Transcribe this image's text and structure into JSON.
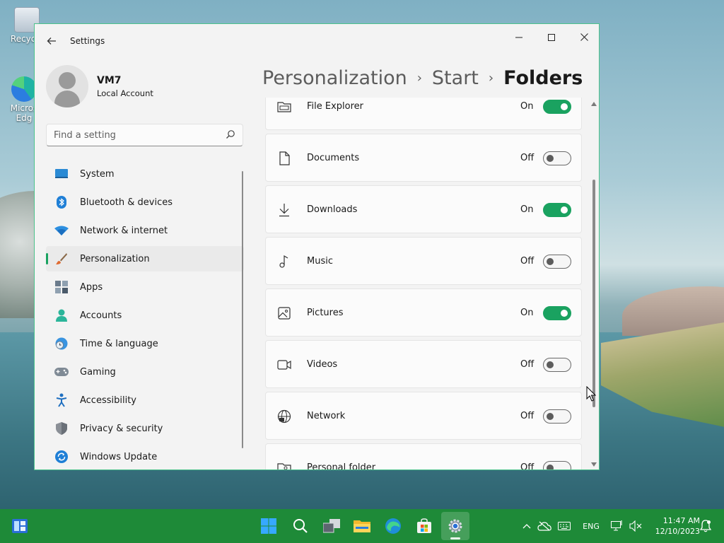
{
  "desktop": {
    "icons": [
      {
        "label": "Recycle"
      },
      {
        "label": "Micros"
      },
      {
        "label": "Edg"
      }
    ]
  },
  "window": {
    "app_title": "Settings",
    "controls": {
      "minimize": "—",
      "maximize": "☐",
      "close": "✕"
    }
  },
  "user": {
    "name": "VM7",
    "account_type": "Local Account"
  },
  "search": {
    "placeholder": "Find a setting"
  },
  "nav": {
    "items": [
      {
        "label": "System",
        "icon": "system-icon"
      },
      {
        "label": "Bluetooth & devices",
        "icon": "bluetooth-icon"
      },
      {
        "label": "Network & internet",
        "icon": "wifi-icon"
      },
      {
        "label": "Personalization",
        "icon": "paintbrush-icon",
        "selected": true
      },
      {
        "label": "Apps",
        "icon": "apps-icon"
      },
      {
        "label": "Accounts",
        "icon": "person-icon"
      },
      {
        "label": "Time & language",
        "icon": "globe-clock-icon"
      },
      {
        "label": "Gaming",
        "icon": "gamepad-icon"
      },
      {
        "label": "Accessibility",
        "icon": "accessibility-icon"
      },
      {
        "label": "Privacy & security",
        "icon": "shield-icon"
      },
      {
        "label": "Windows Update",
        "icon": "update-icon"
      }
    ]
  },
  "breadcrumb": {
    "items": [
      "Personalization",
      "Start",
      "Folders"
    ],
    "separator": "›"
  },
  "folders": [
    {
      "label": "File Explorer",
      "state": "On",
      "on": true,
      "icon": "file-explorer-icon"
    },
    {
      "label": "Documents",
      "state": "Off",
      "on": false,
      "icon": "document-icon"
    },
    {
      "label": "Downloads",
      "state": "On",
      "on": true,
      "icon": "download-icon"
    },
    {
      "label": "Music",
      "state": "Off",
      "on": false,
      "icon": "music-icon"
    },
    {
      "label": "Pictures",
      "state": "On",
      "on": true,
      "icon": "picture-icon"
    },
    {
      "label": "Videos",
      "state": "Off",
      "on": false,
      "icon": "video-icon"
    },
    {
      "label": "Network",
      "state": "Off",
      "on": false,
      "icon": "network-globe-icon"
    },
    {
      "label": "Personal folder",
      "state": "Off",
      "on": false,
      "icon": "personal-folder-icon"
    }
  ],
  "taskbar": {
    "language": "ENG",
    "time": "11:47 AM",
    "date": "12/10/2023"
  },
  "colors": {
    "accent": "#1aa260",
    "taskbar": "#1e8a38",
    "window_border": "#4cc28b"
  }
}
